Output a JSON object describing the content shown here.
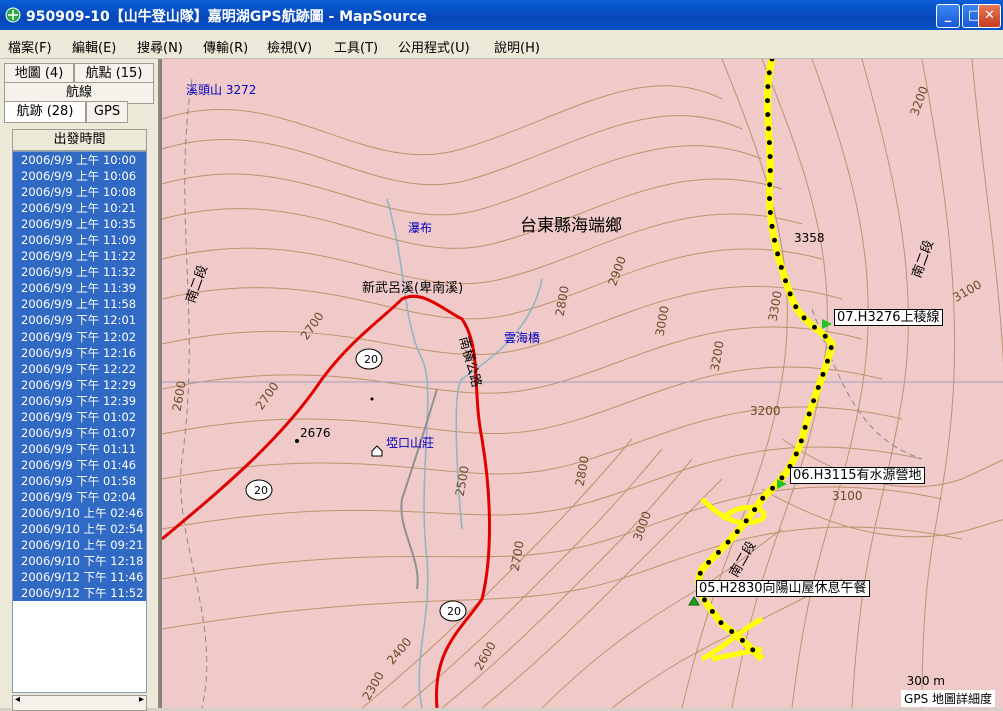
{
  "window": {
    "title": "950909-10【山牛登山隊】嘉明湖GPS航跡圖 - MapSource"
  },
  "menu": [
    "檔案(F)",
    "編輯(E)",
    "搜尋(N)",
    "傳輸(R)",
    "檢視(V)",
    "工具(T)",
    "公用程式(U)",
    "說明(H)"
  ],
  "tabs": {
    "maps": "地圖 (4)",
    "waypoints": "航點 (15)",
    "routes": "航線",
    "tracks": "航跡 (28)",
    "gps": "GPS"
  },
  "list": {
    "header": "出發時間",
    "rows": [
      "2006/9/9 上午 10:00",
      "2006/9/9 上午 10:06",
      "2006/9/9 上午 10:08",
      "2006/9/9 上午 10:21",
      "2006/9/9 上午 10:35",
      "2006/9/9 上午 11:09",
      "2006/9/9 上午 11:22",
      "2006/9/9 上午 11:32",
      "2006/9/9 上午 11:39",
      "2006/9/9 上午 11:58",
      "2006/9/9 下午 12:01",
      "2006/9/9 下午 12:02",
      "2006/9/9 下午 12:16",
      "2006/9/9 下午 12:22",
      "2006/9/9 下午 12:29",
      "2006/9/9 下午 12:39",
      "2006/9/9 下午 01:02",
      "2006/9/9 下午 01:07",
      "2006/9/9 下午 01:11",
      "2006/9/9 下午 01:46",
      "2006/9/9 下午 01:58",
      "2006/9/9 下午 02:04",
      "2006/9/10 上午 02:46",
      "2006/9/10 上午 02:54",
      "2006/9/10 上午 09:21",
      "2006/9/10 下午 12:18",
      "2006/9/12 下午 11:46",
      "2006/9/12 下午 11:52"
    ]
  },
  "map": {
    "peak_label": "溪頭山 3272",
    "county_label": "台東縣海端鄉",
    "waterfall": "瀑布",
    "river": "新武呂溪(卑南溪)",
    "bridge": "雲海橋",
    "hut": "埡口山莊",
    "road": "南橫公路",
    "spot": "2676",
    "spot2": "3358",
    "road_no": "20",
    "sections": [
      "南二段",
      "南二段",
      "南二段"
    ],
    "contours": [
      "2700",
      "2700",
      "2800",
      "2900",
      "3000",
      "3200",
      "3300",
      "3200",
      "3100",
      "3200",
      "2500",
      "2800",
      "3000",
      "2700",
      "2400",
      "2600",
      "2300",
      "3100",
      "2600"
    ],
    "waypoints": [
      "07.H3276上稜線",
      "06.H3115有水源營地",
      "05.H2830向陽山屋休息午餐"
    ],
    "scale": "300 m",
    "status": "GPS 地圖詳細度"
  },
  "colors": {
    "track": "#ffff00",
    "road": "#e00000",
    "contour": "#b48a5a",
    "map_bg": "#f0c9c9"
  }
}
